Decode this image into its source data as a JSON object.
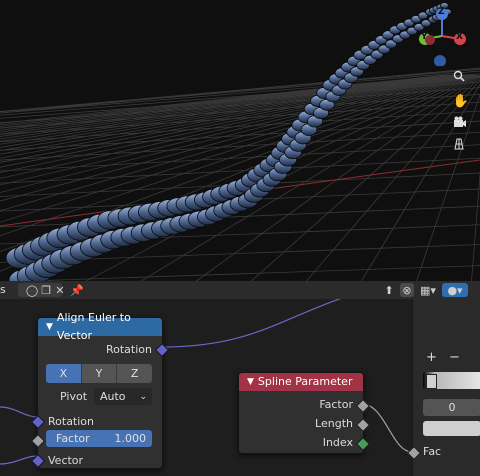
{
  "viewport": {
    "gizmo": {
      "z_label": "Z",
      "y_label": "Y",
      "x_label": "X"
    },
    "tools": {
      "zoom_icon": "zoom-icon",
      "pan_icon": "hand-icon",
      "camera_icon": "camera-icon",
      "grid_icon": "grid-icon"
    }
  },
  "node_header": {
    "left_text": "s",
    "pin_icon": "pin-icon",
    "close_icon": "close-icon"
  },
  "align_node": {
    "title": "Align Euler to Vector",
    "output_label": "Rotation",
    "axis_options": [
      "X",
      "Y",
      "Z"
    ],
    "axis_selected": "X",
    "pivot_label": "Pivot",
    "pivot_value": "Auto",
    "input_rotation_label": "Rotation",
    "factor_label": "Factor",
    "factor_value": "1.000",
    "factor_fraction": 1.0,
    "vector_label": "Vector",
    "colors": {
      "header": "#2d6aa3",
      "rotation_socket": "#6363c7",
      "vector_socket": "#6363c7",
      "float_socket": "#a1a1a1"
    }
  },
  "spline_node": {
    "title": "Spline Parameter",
    "outputs": [
      "Factor",
      "Length",
      "Index"
    ],
    "colors": {
      "header": "#a23245",
      "float_socket": "#a1a1a1",
      "int_socket": "#4a9a5a"
    }
  },
  "side_panel": {
    "plus_label": "+",
    "minus_label": "−",
    "value": "0",
    "fac_label": "Fac"
  }
}
